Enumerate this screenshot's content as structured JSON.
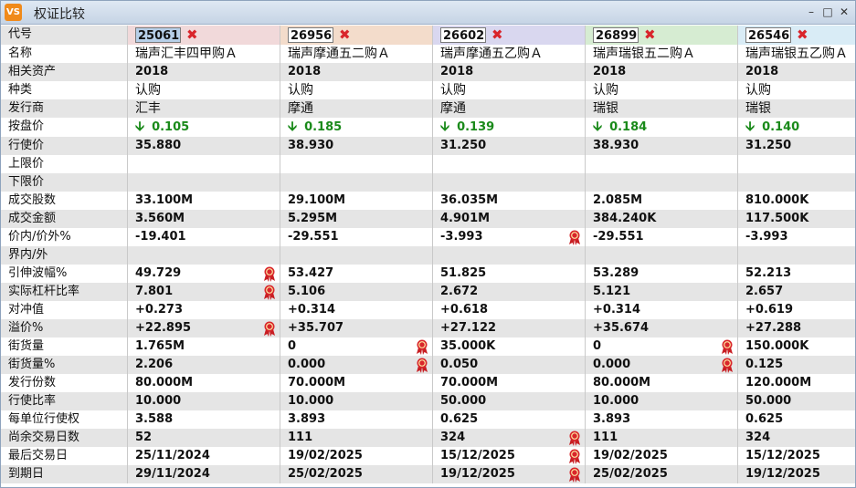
{
  "window": {
    "title": "权证比较",
    "app_icon_text": "VS"
  },
  "columns": [
    {
      "code": "25061",
      "bg": "#f1d9da",
      "selected": true
    },
    {
      "code": "26956",
      "bg": "#f3dccb",
      "selected": false
    },
    {
      "code": "26602",
      "bg": "#d9d7ef",
      "selected": false
    },
    {
      "code": "26899",
      "bg": "#d6ecd2",
      "selected": false
    },
    {
      "code": "26546",
      "bg": "#d9ecf6",
      "selected": false
    }
  ],
  "code_label": "代号",
  "rows": [
    {
      "label": "名称",
      "cn": true,
      "cells": [
        {
          "v": "瑞声汇丰四甲购Ａ"
        },
        {
          "v": "瑞声摩通五二购Ａ"
        },
        {
          "v": "瑞声摩通五乙购Ａ"
        },
        {
          "v": "瑞声瑞银五二购Ａ"
        },
        {
          "v": "瑞声瑞银五乙购Ａ"
        }
      ]
    },
    {
      "label": "相关资产",
      "cells": [
        {
          "v": "2018"
        },
        {
          "v": "2018"
        },
        {
          "v": "2018"
        },
        {
          "v": "2018"
        },
        {
          "v": "2018"
        }
      ]
    },
    {
      "label": "种类",
      "cn": true,
      "cells": [
        {
          "v": "认购"
        },
        {
          "v": "认购"
        },
        {
          "v": "认购"
        },
        {
          "v": "认购"
        },
        {
          "v": "认购"
        }
      ]
    },
    {
      "label": "发行商",
      "cn": true,
      "cells": [
        {
          "v": "汇丰"
        },
        {
          "v": "摩通"
        },
        {
          "v": "摩通"
        },
        {
          "v": "瑞银"
        },
        {
          "v": "瑞银"
        }
      ]
    },
    {
      "label": "按盘价",
      "price": true,
      "cells": [
        {
          "v": "0.105"
        },
        {
          "v": "0.185"
        },
        {
          "v": "0.139"
        },
        {
          "v": "0.184"
        },
        {
          "v": "0.140"
        }
      ]
    },
    {
      "label": "行使价",
      "cells": [
        {
          "v": "35.880"
        },
        {
          "v": "38.930"
        },
        {
          "v": "31.250"
        },
        {
          "v": "38.930"
        },
        {
          "v": "31.250"
        }
      ]
    },
    {
      "label": "上限价",
      "cells": [
        {
          "v": ""
        },
        {
          "v": ""
        },
        {
          "v": ""
        },
        {
          "v": ""
        },
        {
          "v": ""
        }
      ]
    },
    {
      "label": "下限价",
      "cells": [
        {
          "v": ""
        },
        {
          "v": ""
        },
        {
          "v": ""
        },
        {
          "v": ""
        },
        {
          "v": ""
        }
      ]
    },
    {
      "label": "成交股数",
      "cells": [
        {
          "v": "33.100M"
        },
        {
          "v": "29.100M"
        },
        {
          "v": "36.035M"
        },
        {
          "v": "2.085M"
        },
        {
          "v": "810.000K"
        }
      ]
    },
    {
      "label": "成交金额",
      "cells": [
        {
          "v": "3.560M"
        },
        {
          "v": "5.295M"
        },
        {
          "v": "4.901M"
        },
        {
          "v": "384.240K"
        },
        {
          "v": "117.500K"
        }
      ]
    },
    {
      "label": "价内/价外%",
      "cells": [
        {
          "v": "-19.401"
        },
        {
          "v": "-29.551"
        },
        {
          "v": "-3.993",
          "b": true
        },
        {
          "v": "-29.551"
        },
        {
          "v": "-3.993",
          "b": true
        }
      ]
    },
    {
      "label": "界内/外",
      "cells": [
        {
          "v": ""
        },
        {
          "v": ""
        },
        {
          "v": ""
        },
        {
          "v": ""
        },
        {
          "v": ""
        }
      ]
    },
    {
      "label": "引伸波幅%",
      "cells": [
        {
          "v": "49.729",
          "b": true
        },
        {
          "v": "53.427"
        },
        {
          "v": "51.825"
        },
        {
          "v": "53.289"
        },
        {
          "v": "52.213"
        }
      ]
    },
    {
      "label": "实际杠杆比率",
      "cells": [
        {
          "v": "7.801",
          "b": true
        },
        {
          "v": "5.106"
        },
        {
          "v": "2.672"
        },
        {
          "v": "5.121"
        },
        {
          "v": "2.657"
        }
      ]
    },
    {
      "label": "对冲值",
      "cells": [
        {
          "v": "+0.273"
        },
        {
          "v": "+0.314"
        },
        {
          "v": "+0.618"
        },
        {
          "v": "+0.314"
        },
        {
          "v": "+0.619",
          "b": true
        }
      ]
    },
    {
      "label": "溢价%",
      "cells": [
        {
          "v": "+22.895",
          "b": true
        },
        {
          "v": "+35.707"
        },
        {
          "v": "+27.122"
        },
        {
          "v": "+35.674"
        },
        {
          "v": "+27.288"
        }
      ]
    },
    {
      "label": "街货量",
      "cells": [
        {
          "v": "1.765M"
        },
        {
          "v": "0",
          "b": true
        },
        {
          "v": "35.000K"
        },
        {
          "v": "0",
          "b": true
        },
        {
          "v": "150.000K"
        }
      ]
    },
    {
      "label": "街货量%",
      "cells": [
        {
          "v": "2.206"
        },
        {
          "v": "0.000",
          "b": true
        },
        {
          "v": "0.050"
        },
        {
          "v": "0.000",
          "b": true
        },
        {
          "v": "0.125"
        }
      ]
    },
    {
      "label": "发行份数",
      "cells": [
        {
          "v": "80.000M"
        },
        {
          "v": "70.000M"
        },
        {
          "v": "70.000M"
        },
        {
          "v": "80.000M"
        },
        {
          "v": "120.000M"
        }
      ]
    },
    {
      "label": "行使比率",
      "cells": [
        {
          "v": "10.000"
        },
        {
          "v": "10.000"
        },
        {
          "v": "50.000"
        },
        {
          "v": "10.000"
        },
        {
          "v": "50.000"
        }
      ]
    },
    {
      "label": "每单位行使权",
      "cells": [
        {
          "v": "3.588"
        },
        {
          "v": "3.893"
        },
        {
          "v": "0.625"
        },
        {
          "v": "3.893"
        },
        {
          "v": "0.625"
        }
      ]
    },
    {
      "label": "尚余交易日数",
      "cells": [
        {
          "v": "52"
        },
        {
          "v": "111"
        },
        {
          "v": "324",
          "b": true
        },
        {
          "v": "111"
        },
        {
          "v": "324",
          "b": true
        }
      ]
    },
    {
      "label": "最后交易日",
      "cells": [
        {
          "v": "25/11/2024"
        },
        {
          "v": "19/02/2025"
        },
        {
          "v": "15/12/2025",
          "b": true
        },
        {
          "v": "19/02/2025"
        },
        {
          "v": "15/12/2025",
          "b": true
        }
      ]
    },
    {
      "label": "到期日",
      "cells": [
        {
          "v": "29/11/2024"
        },
        {
          "v": "25/02/2025"
        },
        {
          "v": "19/12/2025",
          "b": true
        },
        {
          "v": "25/02/2025"
        },
        {
          "v": "19/12/2025",
          "b": true
        }
      ]
    }
  ],
  "icons": {
    "remove": "close-icon",
    "price_down": "arrow-down-icon",
    "badge": "ribbon-badge-icon"
  },
  "colors": {
    "price_green": "#1a8a1a",
    "remove_red": "#d9252b",
    "badge_red": "#d9252b"
  }
}
